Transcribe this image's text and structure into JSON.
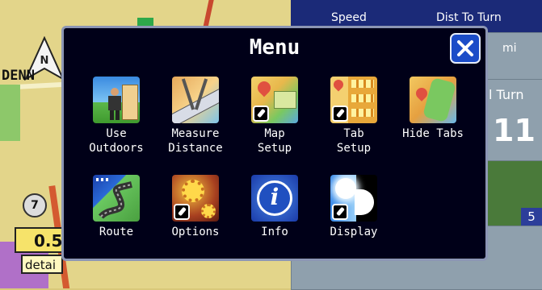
{
  "background": {
    "map_label": "DENN",
    "scale_badge": "7",
    "distance_badge": "0.5",
    "detail_badge": "detai",
    "dashboard": {
      "speed_header": "Speed",
      "dist_turn_header": "Dist To Turn",
      "turn_header": "l Turn",
      "turn_value": "11",
      "road_badge": "5",
      "dist_unit": "mi"
    }
  },
  "menu": {
    "title": "Menu",
    "close_symbol": "✕",
    "items": [
      {
        "label": "Use\nOutdoors",
        "icon": "person-outdoors-icon"
      },
      {
        "label": "Measure\nDistance",
        "icon": "measure-distance-icon"
      },
      {
        "label": "Map\nSetup",
        "icon": "map-setup-icon"
      },
      {
        "label": "Tab\nSetup",
        "icon": "tab-setup-icon"
      },
      {
        "label": "Hide Tabs",
        "icon": "hide-tabs-icon"
      },
      {
        "label": "Route",
        "icon": "route-icon"
      },
      {
        "label": "Options",
        "icon": "options-gear-icon"
      },
      {
        "label": "Info",
        "icon": "info-icon"
      },
      {
        "label": "Display",
        "icon": "display-brightness-icon"
      }
    ]
  },
  "colors": {
    "menu_bg": "#000018",
    "close_button": "#1b4cc8",
    "dashboard_navy": "#1b2a78"
  }
}
